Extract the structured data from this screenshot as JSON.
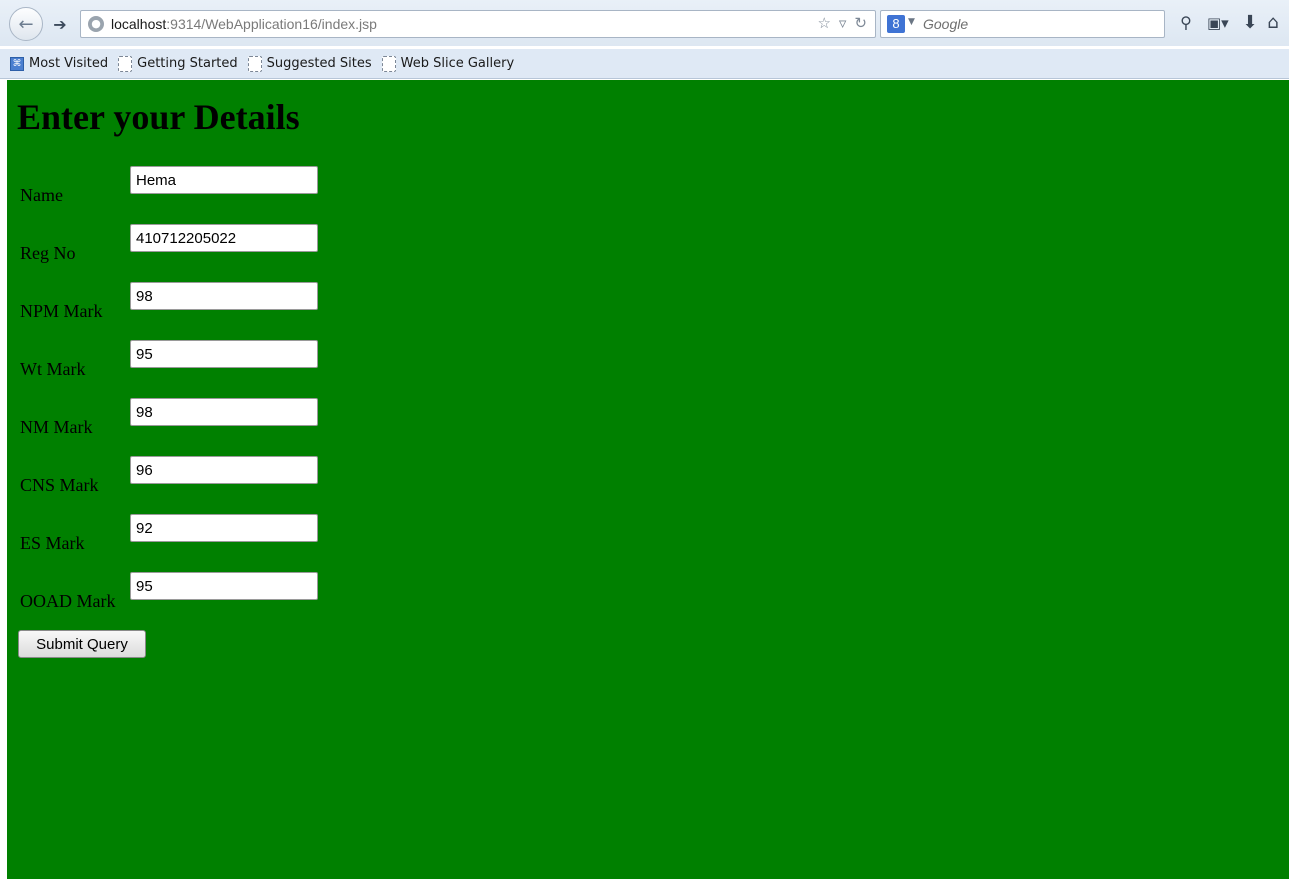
{
  "browser": {
    "url": {
      "host": "localhost",
      "rest": ":9314/WebApplication16/index.jsp"
    },
    "search_placeholder": "Google",
    "bookmarks": [
      {
        "label": "Most Visited"
      },
      {
        "label": "Getting Started"
      },
      {
        "label": "Suggested Sites"
      },
      {
        "label": "Web Slice Gallery"
      }
    ],
    "icons": [
      "back-arrow-icon",
      "forward-arrow-icon",
      "globe-icon",
      "star-icon",
      "dropdown-icon",
      "reload-icon",
      "search-engine-icon",
      "magnifier-icon",
      "bookmarks-menu-icon",
      "download-icon",
      "home-icon"
    ]
  },
  "page": {
    "background_color": "#008000",
    "title": "Enter your Details",
    "fields": [
      {
        "label": "Name",
        "value": "Hema"
      },
      {
        "label": "Reg No",
        "value": "410712205022"
      },
      {
        "label": "NPM Mark",
        "value": "98"
      },
      {
        "label": "Wt Mark",
        "value": "95"
      },
      {
        "label": "NM Mark",
        "value": "98"
      },
      {
        "label": "CNS Mark",
        "value": "96"
      },
      {
        "label": "ES Mark",
        "value": "92"
      },
      {
        "label": "OOAD Mark",
        "value": "95"
      }
    ],
    "submit_label": "Submit Query"
  }
}
